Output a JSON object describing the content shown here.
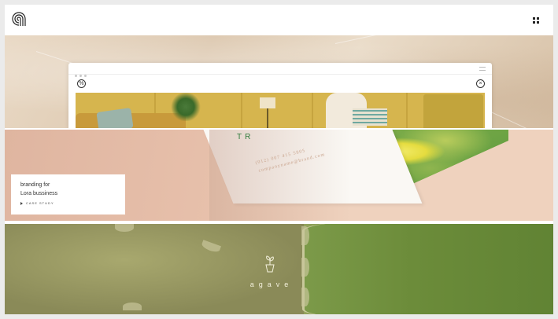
{
  "header": {
    "logo_icon": "concentric-arcs-logo-icon",
    "menu_icon": "grid-menu-icon"
  },
  "showcase": {
    "browser_left_icon": "percent-icon",
    "browser_right_icon": "close-icon"
  },
  "branding_panel": {
    "card_brand": "TR",
    "card_phone": "(012) 007 415 5805",
    "card_email": "companyname@brand.com",
    "promo_title_line1": "branding for",
    "promo_title_line2": "Lora bussiness",
    "promo_link": "CASE STUDY",
    "promo_icon": "play-arrow-icon"
  },
  "agave_panel": {
    "icon": "potted-plant-icon",
    "brand": "agave"
  },
  "colors": {
    "accent_green": "#2e7a3a",
    "peach": "#efd2be",
    "olive": "#8d8d59"
  }
}
